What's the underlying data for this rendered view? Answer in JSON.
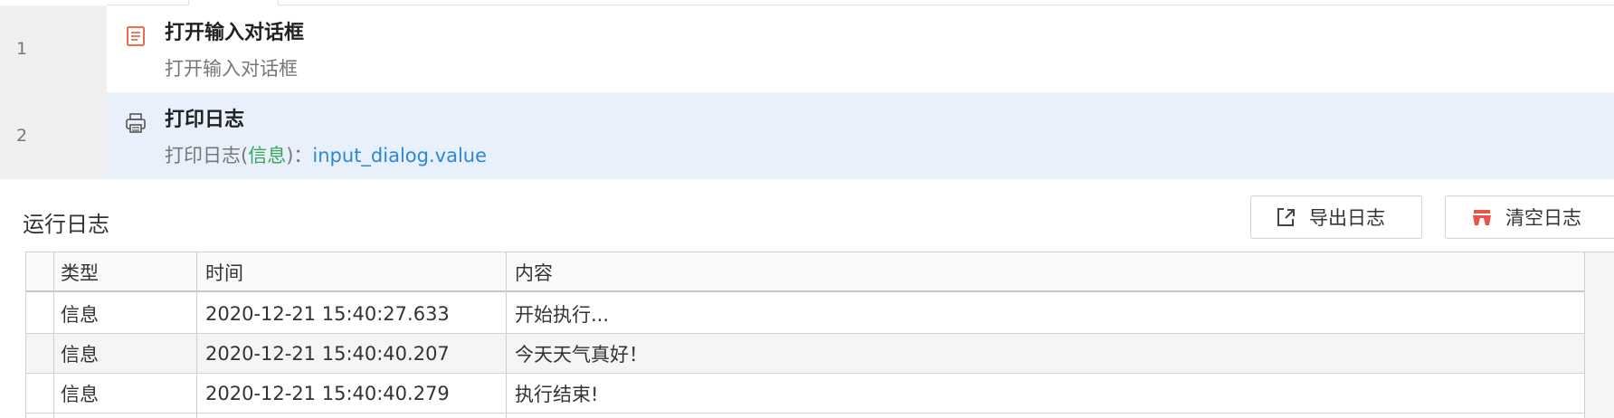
{
  "steps": [
    {
      "number": "1",
      "icon": "dialog-form-icon",
      "title": "打开输入对话框",
      "description": "打开输入对话框",
      "selected": false
    },
    {
      "number": "2",
      "icon": "printer-icon",
      "title": "打印日志",
      "description_prefix": "打印日志(",
      "description_level": "信息",
      "description_mid": ")：",
      "description_expr": "input_dialog.value",
      "selected": true
    }
  ],
  "log_panel": {
    "title": "运行日志",
    "export_button": {
      "label": "导出日志",
      "icon": "export-icon"
    },
    "clear_button": {
      "label": "清空日志",
      "icon": "clear-icon"
    },
    "columns": [
      "类型",
      "时间",
      "内容"
    ],
    "rows": [
      {
        "type": "信息",
        "time": "2020-12-21 15:40:27.633",
        "content": "开始执行..."
      },
      {
        "type": "信息",
        "time": "2020-12-21 15:40:40.207",
        "content": "今天天气真好！"
      },
      {
        "type": "信息",
        "time": "2020-12-21 15:40:40.279",
        "content": "执行结束!"
      }
    ]
  },
  "colors": {
    "selected_row_bg": "#e8f0fb",
    "level_green": "#3aa757",
    "expression_blue": "#2b88d8",
    "clear_icon_red": "#e8534b"
  }
}
